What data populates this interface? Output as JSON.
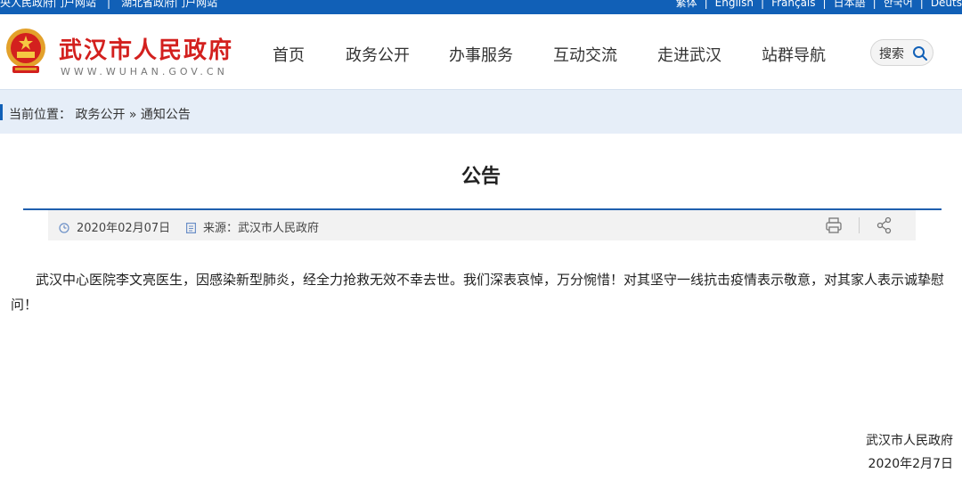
{
  "topbar": {
    "left_links": [
      "央人民政府门户网站",
      "湖北省政府门户网站"
    ],
    "languages": [
      "繁体",
      "English",
      "Français",
      "日本語",
      "한국어",
      "Deuts"
    ]
  },
  "header": {
    "site_title": "武汉市人民政府",
    "site_url": "WWW.WUHAN.GOV.CN",
    "nav": [
      "首页",
      "政务公开",
      "办事服务",
      "互动交流",
      "走进武汉",
      "站群导航"
    ],
    "search_label": "搜索"
  },
  "breadcrumb": {
    "text": "当前位置： 政务公开 » 通知公告"
  },
  "article": {
    "title": "公告",
    "date": "2020年02月07日",
    "source": "来源：武汉市人民政府",
    "body": "武汉中心医院李文亮医生，因感染新型肺炎，经全力抢救无效不幸去世。我们深表哀悼，万分惋惜！对其坚守一线抗击疫情表示敬意，对其家人表示诚挚慰问！",
    "signature_org": "武汉市人民政府",
    "signature_date": "2020年2月7日"
  },
  "colors": {
    "topbar": "#1160b7",
    "title_red": "#d3201e",
    "breadcrumb_bg": "#e6eef8"
  },
  "icons": [
    "national-emblem-icon",
    "search-icon",
    "clock-icon",
    "document-icon",
    "print-icon",
    "share-icon"
  ]
}
